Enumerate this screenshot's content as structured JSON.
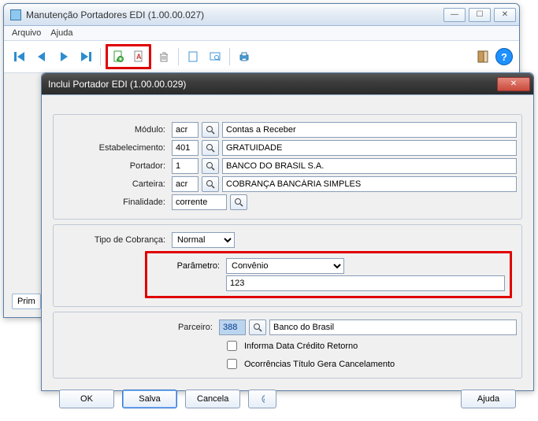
{
  "parent": {
    "title": "Manutenção Portadores EDI (1.00.00.027)",
    "menu": {
      "arquivo": "Arquivo",
      "ajuda": "Ajuda"
    },
    "toolbar_hint": "Prim"
  },
  "dialog": {
    "title": "Inclui Portador EDI (1.00.00.029)",
    "labels": {
      "modulo": "Módulo:",
      "estab": "Estabelecimento:",
      "portador": "Portador:",
      "carteira": "Carteira:",
      "finalidade": "Finalidade:",
      "tipo_cobranca": "Tipo de Cobrança:",
      "parametro": "Parâmetro:",
      "parceiro": "Parceiro:"
    },
    "fields": {
      "modulo_code": "acr",
      "modulo_desc": "Contas a Receber",
      "estab_code": "401",
      "estab_desc": "GRATUIDADE",
      "portador_code": "1",
      "portador_desc": "BANCO DO BRASIL S.A.",
      "carteira_code": "acr",
      "carteira_desc": "COBRANÇA BANCÁRIA SIMPLES",
      "finalidade": "corrente",
      "tipo_cobranca": "Normal",
      "parametro": "Convênio",
      "parametro_valor": "123",
      "parceiro_code": "388",
      "parceiro_desc": "Banco do Brasil"
    },
    "checks": {
      "informa_data": "Informa Data Crédito Retorno",
      "ocorrencias": "Ocorrências Título Gera Cancelamento"
    },
    "buttons": {
      "ok": "OK",
      "salva": "Salva",
      "cancela": "Cancela",
      "ajuda": "Ajuda"
    }
  }
}
